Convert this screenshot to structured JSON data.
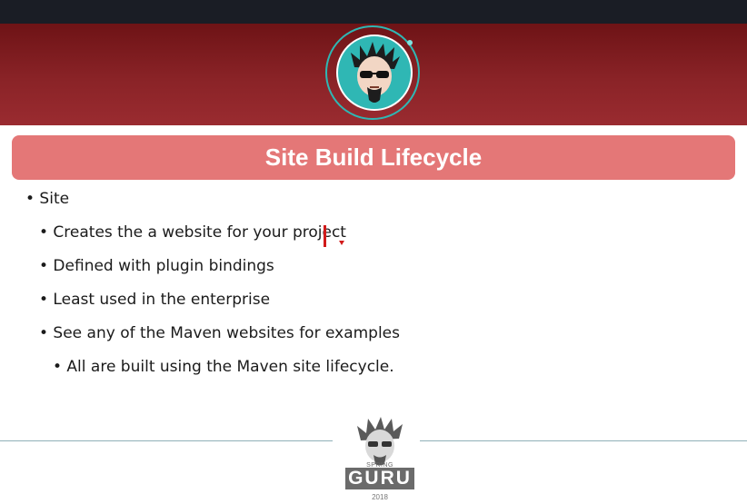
{
  "slide": {
    "title": "Site Build Lifecycle",
    "bullets": [
      {
        "text": "• Site",
        "level": 0
      },
      {
        "text": "• Creates the a website for your project",
        "level": 1
      },
      {
        "text": "• Defined with plugin bindings",
        "level": 1
      },
      {
        "text": "• Least used in the enterprise",
        "level": 1
      },
      {
        "text": "• See any of the Maven websites for examples",
        "level": 1
      },
      {
        "text": "• All are built using the Maven site lifecycle.",
        "level": 2
      }
    ]
  },
  "footer": {
    "tagline": "SPRING FRAMEWORK",
    "brand": "GURU",
    "year": "2018"
  },
  "colors": {
    "header": "#8a2327",
    "title_bar": "#e47777",
    "accent_ring": "#2fb7b4",
    "annotation": "#d11a1a"
  }
}
